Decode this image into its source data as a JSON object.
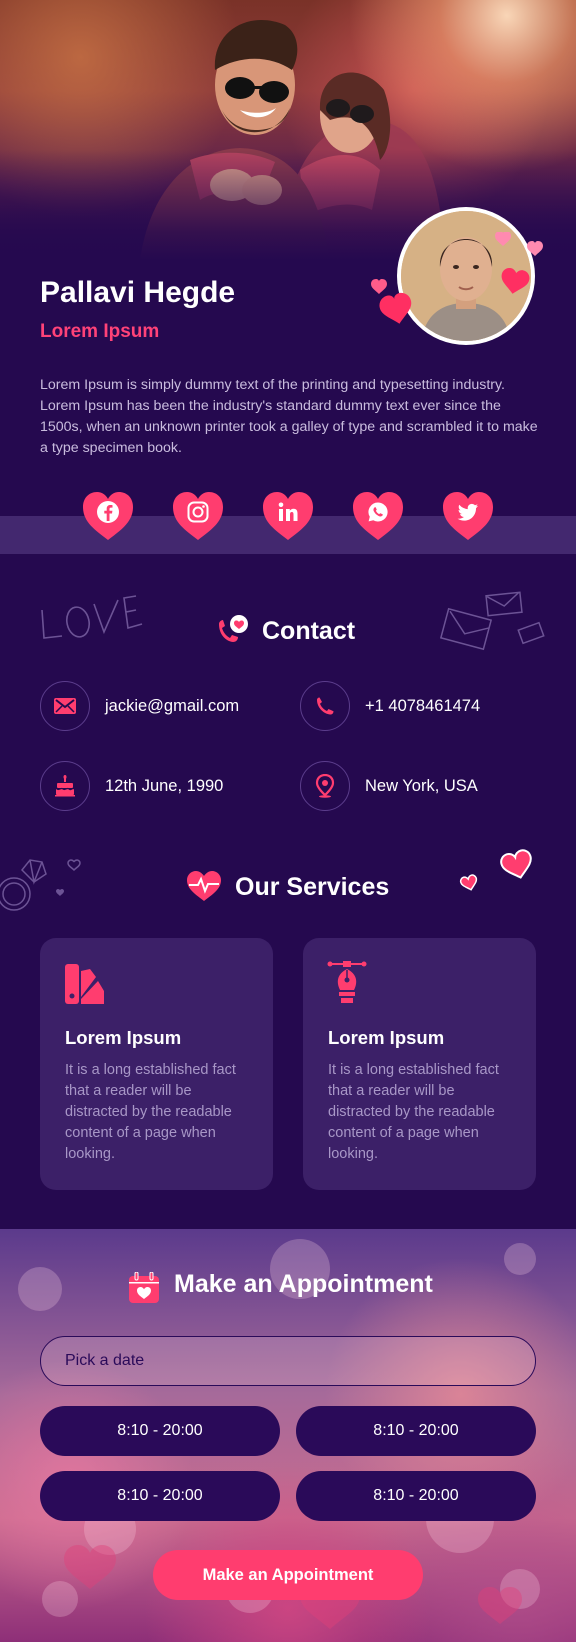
{
  "profile": {
    "name": "Pallavi Hegde",
    "role": "Lorem Ipsum",
    "bio": "Lorem Ipsum is simply dummy text of the printing and typesetting industry. Lorem Ipsum has been the industry's standard dummy text ever since the 1500s, when an unknown printer took a galley of type and scrambled it to make a type specimen book."
  },
  "social": [
    "facebook-icon",
    "instagram-icon",
    "linkedin-icon",
    "whatsapp-icon",
    "twitter-icon"
  ],
  "contact": {
    "title": "Contact",
    "email": "jackie@gmail.com",
    "phone": "+1 4078461474",
    "birthday": "12th June, 1990",
    "location": "New York, USA"
  },
  "services": {
    "title": "Our Services",
    "items": [
      {
        "title": "Lorem Ipsum",
        "text": "It is a long established fact that a reader will be distracted by the readable content of a page when looking.",
        "icon": "color-swatch-icon"
      },
      {
        "title": "Lorem Ipsum",
        "text": "It is a long established fact that a reader will be distracted by the readable content of a page when looking.",
        "icon": "pen-tool-icon"
      }
    ]
  },
  "appointment": {
    "title": "Make an Appointment",
    "date_placeholder": "Pick a date",
    "slots": [
      "8:10 - 20:00",
      "8:10 - 20:00",
      "8:10 - 20:00",
      "8:10 - 20:00"
    ],
    "cta": "Make an Appointment"
  },
  "colors": {
    "background": "#25094f",
    "accent": "#ff4278",
    "card": "#3c2068",
    "slot": "#2a0a59"
  }
}
